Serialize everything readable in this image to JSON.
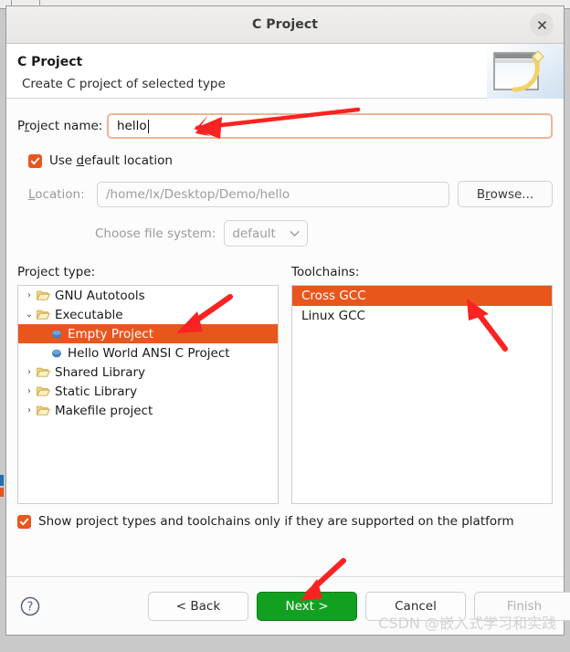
{
  "window": {
    "title": "C Project",
    "close_icon": "close-icon"
  },
  "header": {
    "title": "C Project",
    "subtitle": "Create C project of selected type",
    "icon": "wizard-banner-icon"
  },
  "form": {
    "project_name_label_pre": "P",
    "project_name_label_key": "r",
    "project_name_label_post": "oject name:",
    "project_name_value": "hello",
    "use_default_label_pre": "Use ",
    "use_default_label_key": "d",
    "use_default_label_post": "efault location",
    "use_default_checked": true,
    "location_label_key": "L",
    "location_label_post": "ocation:",
    "location_value": "/home/lx/Desktop/Demo/hello",
    "browse_label_pre": "B",
    "browse_label_key": "r",
    "browse_label_post": "owse...",
    "filesystem_label": "Choose file system:",
    "filesystem_value": "default",
    "filesystem_chevron": "chevron-down-icon"
  },
  "project_type": {
    "caption": "Project type:",
    "items": [
      {
        "label": "GNU Autotools",
        "level": 0,
        "twisty": "›",
        "icon": "folder-icon",
        "selected": false
      },
      {
        "label": "Executable",
        "level": 0,
        "twisty": "⌄",
        "icon": "folder-icon",
        "selected": false
      },
      {
        "label": "Empty Project",
        "level": 1,
        "twisty": "",
        "icon": "sphere-icon",
        "selected": true
      },
      {
        "label": "Hello World ANSI C Project",
        "level": 1,
        "twisty": "",
        "icon": "sphere-icon",
        "selected": false
      },
      {
        "label": "Shared Library",
        "level": 0,
        "twisty": "›",
        "icon": "folder-icon",
        "selected": false
      },
      {
        "label": "Static Library",
        "level": 0,
        "twisty": "›",
        "icon": "folder-icon",
        "selected": false
      },
      {
        "label": "Makefile project",
        "level": 0,
        "twisty": "›",
        "icon": "folder-icon",
        "selected": false
      }
    ]
  },
  "toolchains": {
    "caption": "Toolchains:",
    "items": [
      {
        "label": "Cross GCC",
        "selected": true
      },
      {
        "label": "Linux GCC",
        "selected": false
      }
    ]
  },
  "show_supported": {
    "label": "Show project types and toolchains only if they are supported on the platform",
    "checked": true
  },
  "footer": {
    "help_icon": "help-icon",
    "back_label": "< Back",
    "next_label": "Next >",
    "cancel_label": "Cancel",
    "finish_label": "Finish",
    "finish_disabled": true
  },
  "watermark": {
    "text": "CSDN @嵌入式学习和实践"
  },
  "colors": {
    "selection_orange": "#e8561e",
    "primary_green": "#12a020",
    "focus_border": "#f0b49a",
    "annotation_red": "#fb2222"
  }
}
